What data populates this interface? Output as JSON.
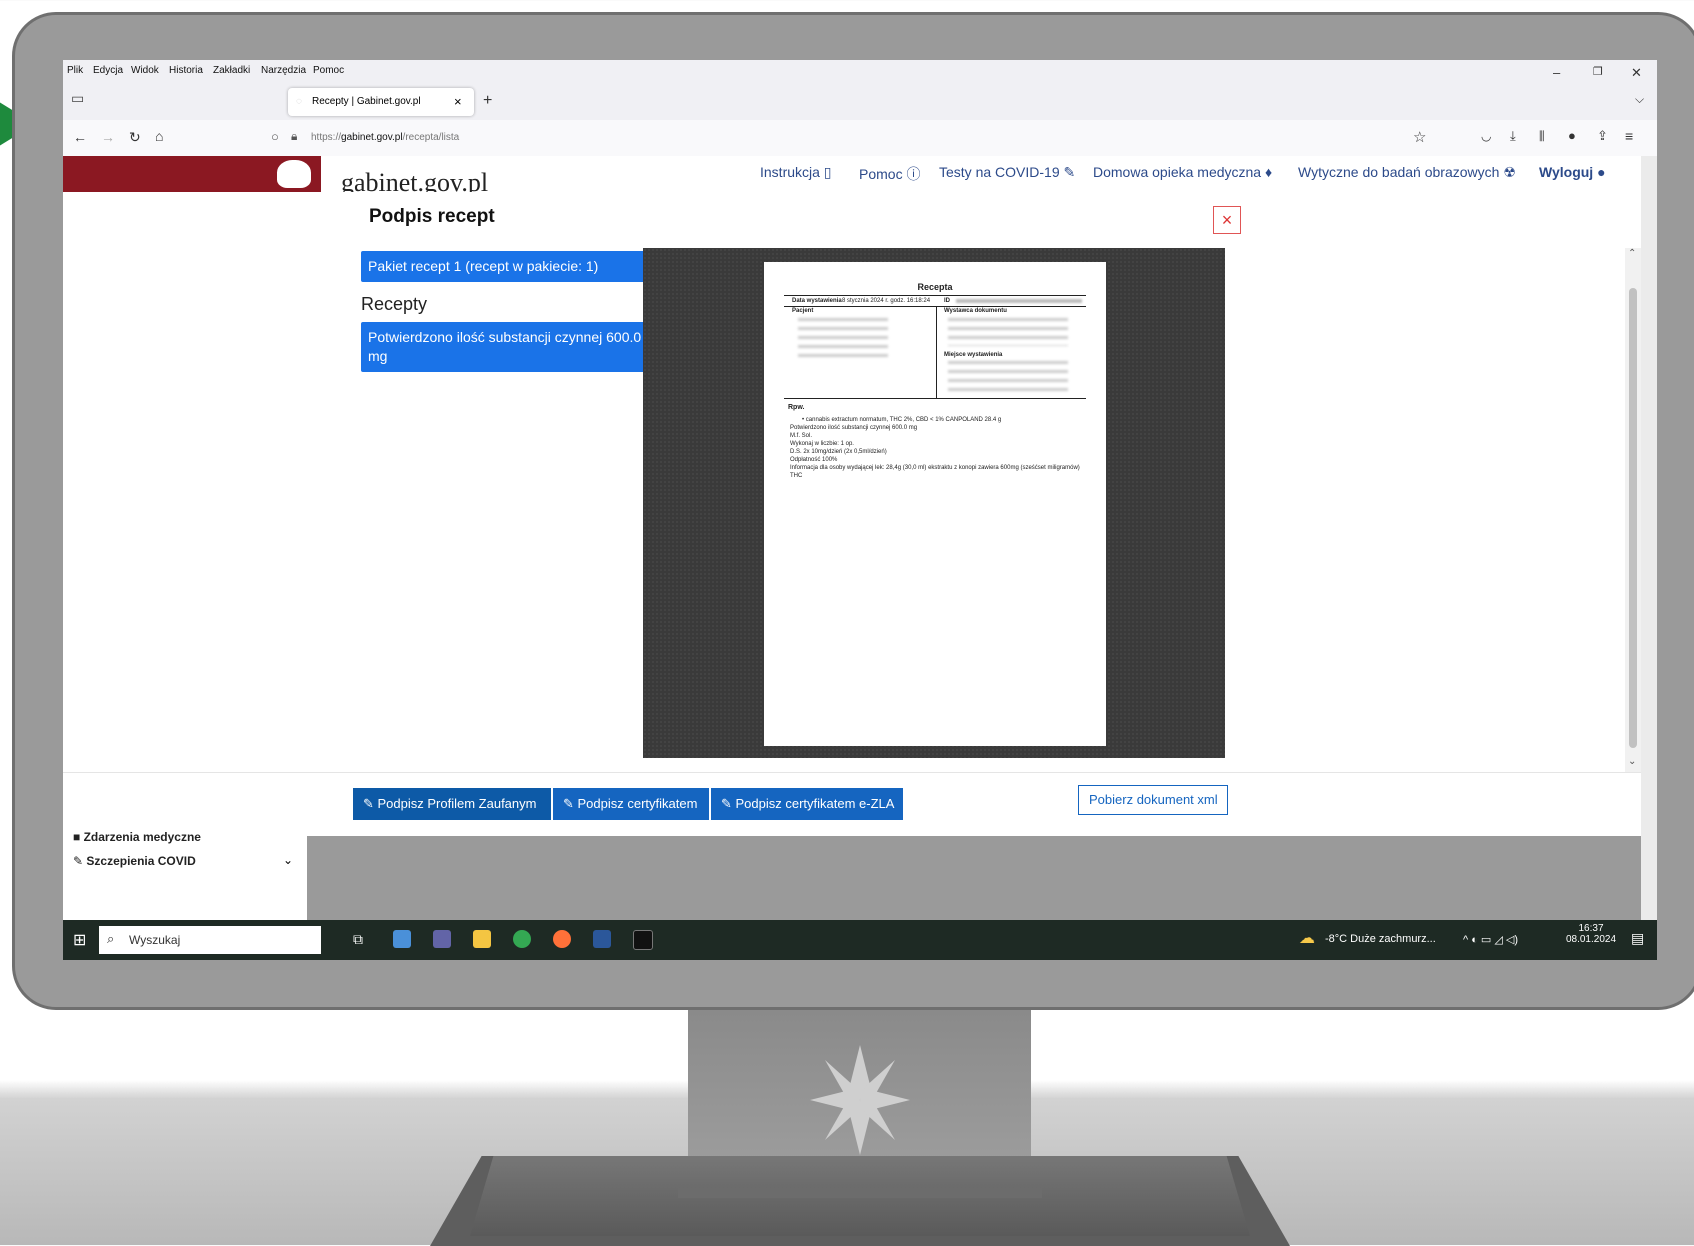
{
  "menu": {
    "file": "Plik",
    "edit": "Edycja",
    "view": "Widok",
    "history": "Historia",
    "bookmarks": "Zakładki",
    "tools": "Narzędzia",
    "help": "Pomoc"
  },
  "tab": {
    "title": "Recepty | Gabinet.gov.pl",
    "close": "×",
    "new": "+"
  },
  "url": {
    "prefix": "https://",
    "host": "gabinet.gov.pl",
    "path": "/recepta/lista"
  },
  "header": {
    "brand": "gabinet.gov.pl",
    "nav": {
      "instrukcja": "Instrukcja",
      "pomoc": "Pomoc",
      "covid": "Testy na COVID-19",
      "opieka": "Domowa opieka medyczna",
      "wytyczne": "Wytyczne do badań obrazowych",
      "logout": "Wyloguj"
    }
  },
  "modal": {
    "title": "Podpis recept",
    "close": "×",
    "package": "Pakiet recept 1 (recept w pakiecie: 1)",
    "section": "Recepty",
    "confirmed": "Potwierdzono ilość substancji czynnej 600.0 mg",
    "buttons": {
      "trusted": "Podpisz Profilem Zaufanym",
      "cert": "Podpisz certyfikatem",
      "cert_zla": "Podpisz certyfikatem e-ZLA",
      "xml": "Pobierz dokument xml"
    }
  },
  "document": {
    "title": "Recepta",
    "date_label": "Data wystawienia",
    "date": "8 stycznia 2024 r. godz. 16:18:24",
    "id_label": "ID",
    "patient": "Pacjent",
    "issuer": "Wystawca dokumentu",
    "place": "Miejsce wystawienia",
    "rpw": "Rpw.",
    "lines": [
      "• cannabis extractum normatum, THC 2%, CBD < 1% CANPOLAND 28.4 g",
      "Potwierdzono ilość substancji czynnej 600.0 mg",
      "M.f. Sol.",
      "Wykonaj w liczbie: 1 op.",
      "D.S. 2x 10mg/dzień (2x 0,5ml/dzień)",
      "Odpłatność 100%",
      "Informacja dla osoby wydającej lek: 28,4g (30,0 ml) ekstraktu z konopi zawiera 600mg (sześćset miligramów) THC"
    ]
  },
  "sidebar": {
    "item1": "Zdarzenia medyczne",
    "item2": "Szczepienia COVID"
  },
  "taskbar": {
    "search": "Wyszukaj",
    "weather": "-8°C Duże zachmurz...",
    "time": "16:37",
    "date": "08.01.2024"
  }
}
